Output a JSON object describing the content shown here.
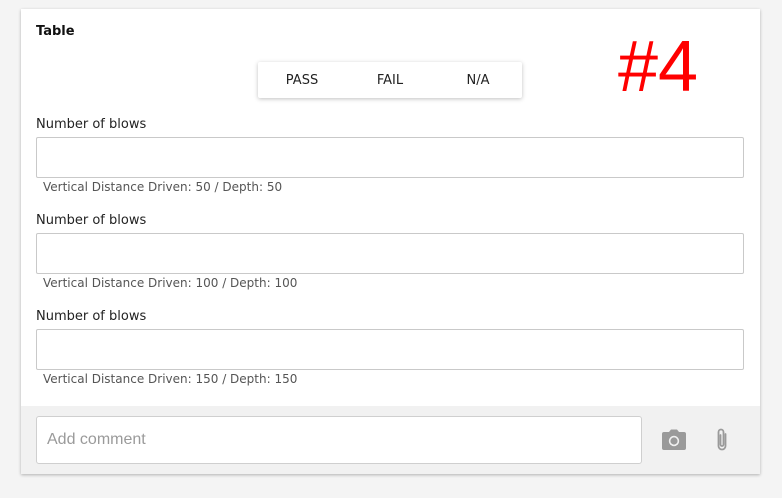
{
  "card": {
    "title": "Table",
    "annotation": "#4"
  },
  "result_options": [
    "PASS",
    "FAIL",
    "N/A"
  ],
  "fields": [
    {
      "label": "Number of blows",
      "value": "",
      "hint": "Vertical Distance Driven: 50 / Depth: 50"
    },
    {
      "label": "Number of blows",
      "value": "",
      "hint": "Vertical Distance Driven: 100 / Depth: 100"
    },
    {
      "label": "Number of blows",
      "value": "",
      "hint": "Vertical Distance Driven: 150 / Depth: 150"
    }
  ],
  "footer": {
    "comment_placeholder": "Add comment",
    "icons": [
      "camera-icon",
      "paperclip-icon"
    ]
  },
  "colors": {
    "annotation": "#ff0000",
    "icon": "#9a9a9a",
    "footer_bg": "#f1f1f1"
  }
}
